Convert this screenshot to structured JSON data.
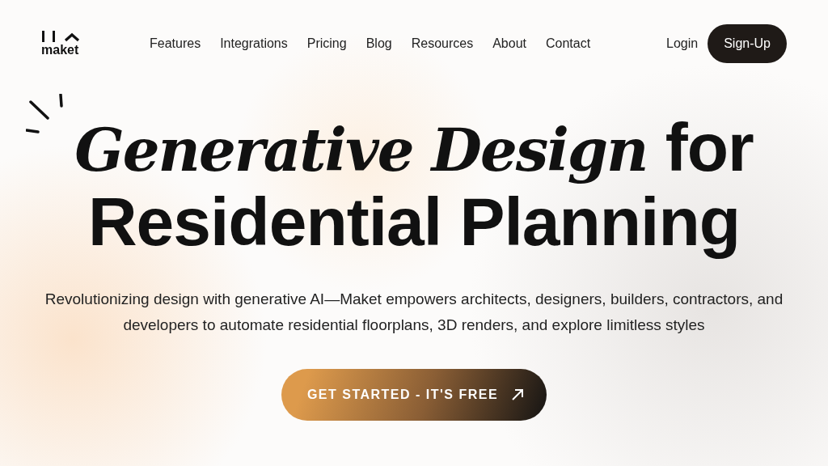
{
  "logo": {
    "text": "maket"
  },
  "nav": {
    "links": [
      "Features",
      "Integrations",
      "Pricing",
      "Blog",
      "Resources",
      "About",
      "Contact"
    ],
    "login": "Login",
    "signup": "Sign-Up"
  },
  "hero": {
    "headline": [
      "*Generative Design* for",
      "Residential Planning"
    ],
    "subtitle": "Revolutionizing design with generative AI—Maket empowers architects, designers, builders, contractors, and developers to automate residential floorplans, 3D renders, and explore limitless styles",
    "cta": "GET STARTED - IT'S FREE"
  }
}
